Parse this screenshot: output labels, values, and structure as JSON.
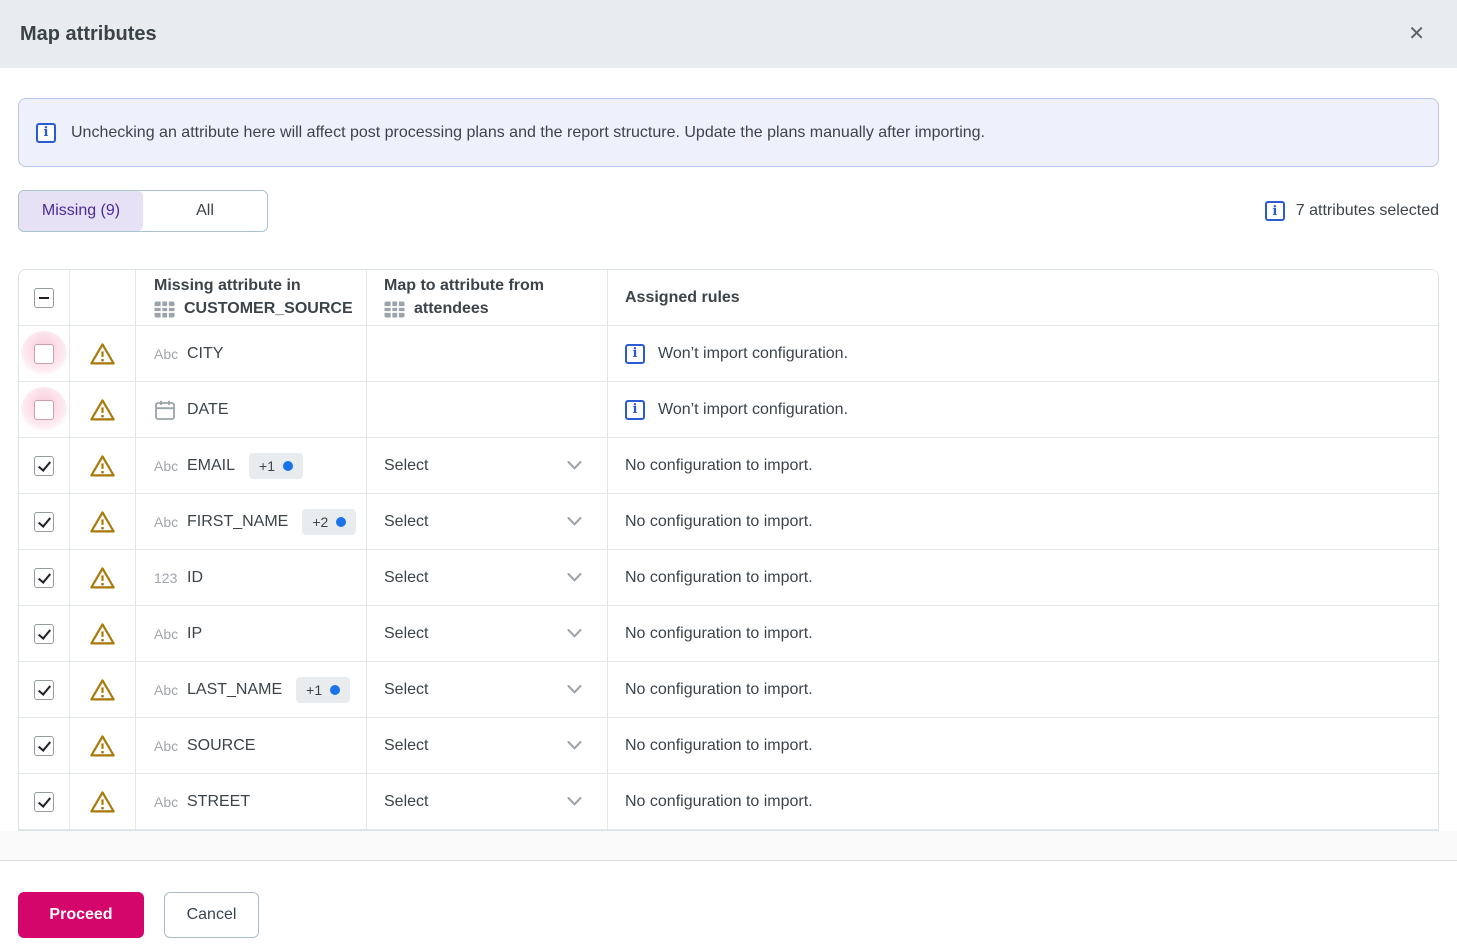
{
  "dialog": {
    "title": "Map attributes"
  },
  "icons": {
    "close_glyph": "✕",
    "info_glyph": "i"
  },
  "banner": {
    "text": "Unchecking an attribute here will affect post processing plans and the report structure. Update the plans manually after importing."
  },
  "tabs": {
    "missing_label": "Missing (9)",
    "all_label": "All"
  },
  "summary": {
    "text": "7 attributes selected"
  },
  "table": {
    "header": {
      "missing_line1": "Missing attribute in",
      "missing_source": "CUSTOMER_SOURCE",
      "map_line1": "Map to attribute from",
      "map_source": "attendees",
      "assigned_rules": "Assigned rules"
    },
    "rows": [
      {
        "name": "CITY",
        "type": "text",
        "type_label": "Abc",
        "checked": false,
        "badge": "",
        "select": "",
        "rule": "Won’t import configuration.",
        "rule_info": true
      },
      {
        "name": "DATE",
        "type": "date",
        "type_label": "",
        "checked": false,
        "badge": "",
        "select": "",
        "rule": "Won’t import configuration.",
        "rule_info": true
      },
      {
        "name": "EMAIL",
        "type": "text",
        "type_label": "Abc",
        "checked": true,
        "badge": "+1",
        "select": "Select",
        "rule": "No configuration to import.",
        "rule_info": false
      },
      {
        "name": "FIRST_NAME",
        "type": "text",
        "type_label": "Abc",
        "checked": true,
        "badge": "+2",
        "select": "Select",
        "rule": "No configuration to import.",
        "rule_info": false
      },
      {
        "name": "ID",
        "type": "number",
        "type_label": "123",
        "checked": true,
        "badge": "",
        "select": "Select",
        "rule": "No configuration to import.",
        "rule_info": false
      },
      {
        "name": "IP",
        "type": "text",
        "type_label": "Abc",
        "checked": true,
        "badge": "",
        "select": "Select",
        "rule": "No configuration to import.",
        "rule_info": false
      },
      {
        "name": "LAST_NAME",
        "type": "text",
        "type_label": "Abc",
        "checked": true,
        "badge": "+1",
        "select": "Select",
        "rule": "No configuration to import.",
        "rule_info": false
      },
      {
        "name": "SOURCE",
        "type": "text",
        "type_label": "Abc",
        "checked": true,
        "badge": "",
        "select": "Select",
        "rule": "No configuration to import.",
        "rule_info": false
      },
      {
        "name": "STREET",
        "type": "text",
        "type_label": "Abc",
        "checked": true,
        "badge": "",
        "select": "Select",
        "rule": "No configuration to import.",
        "rule_info": false
      }
    ]
  },
  "footer": {
    "proceed_label": "Proceed",
    "cancel_label": "Cancel"
  },
  "colors": {
    "titlebar_bg": "#e8ecee",
    "banner_bg": "#eef1fc",
    "banner_border": "#b9c5ec",
    "info_blue": "#2a5ad4",
    "tab_selected_bg": "#e7e1f6",
    "tab_selected_text": "#4b2a9b",
    "warning_amber": "#a87908",
    "badge_dot_blue": "#1a73e8",
    "accent_magenta": "#d4056b"
  }
}
